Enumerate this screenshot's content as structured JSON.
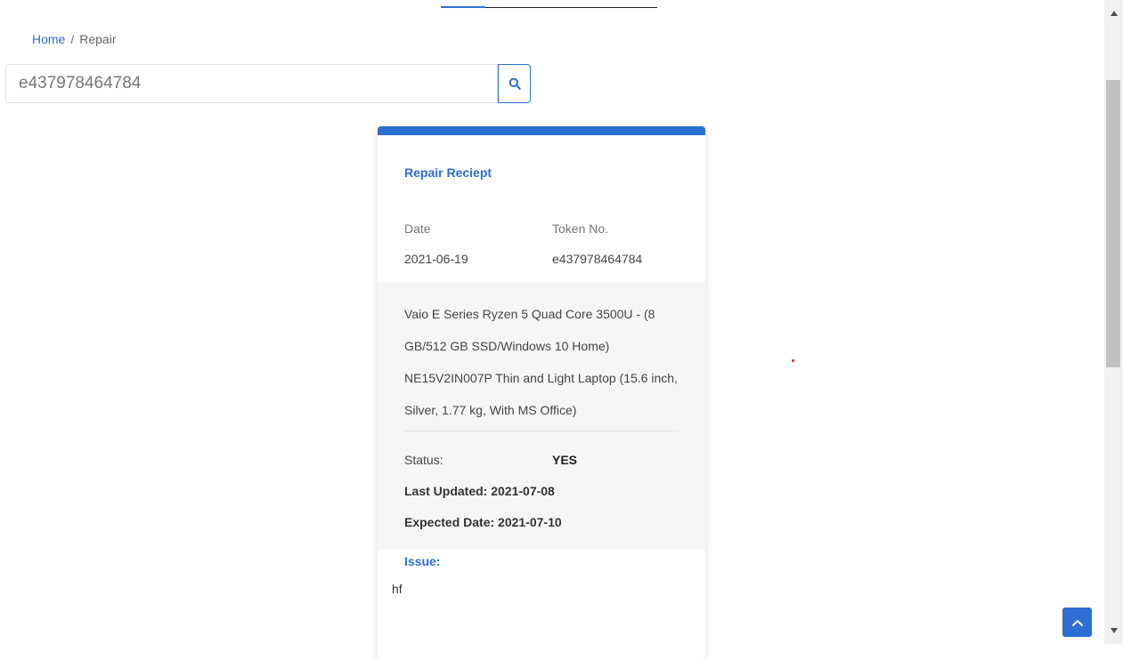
{
  "breadcrumb": {
    "home": "Home",
    "separator": "/",
    "current": "Repair"
  },
  "search": {
    "value": "e437978464784",
    "button_icon": "search-icon"
  },
  "receipt": {
    "title": "Repair Reciept",
    "date_label": "Date",
    "token_label": "Token No.",
    "date_value": "2021-06-19",
    "token_value": "e437978464784",
    "product": "Vaio E Series Ryzen 5 Quad Core 3500U - (8 GB/512 GB SSD/Windows 10 Home) NE15V2IN007P Thin and Light Laptop (15.6 inch, Silver, 1.77 kg, With MS Office)",
    "status_label": "Status:",
    "status_value": "YES",
    "last_updated": "Last Updated: 2021-07-08",
    "expected_date": "Expected Date: 2021-07-10",
    "issue_label": "Issue:",
    "issue_text": "hf"
  },
  "back_to_top_icon": "chevron-up-icon",
  "colors": {
    "accent": "#2c6fd1",
    "panel": "#f6f6f6",
    "scrollbar_thumb": "#c1c1c1"
  }
}
